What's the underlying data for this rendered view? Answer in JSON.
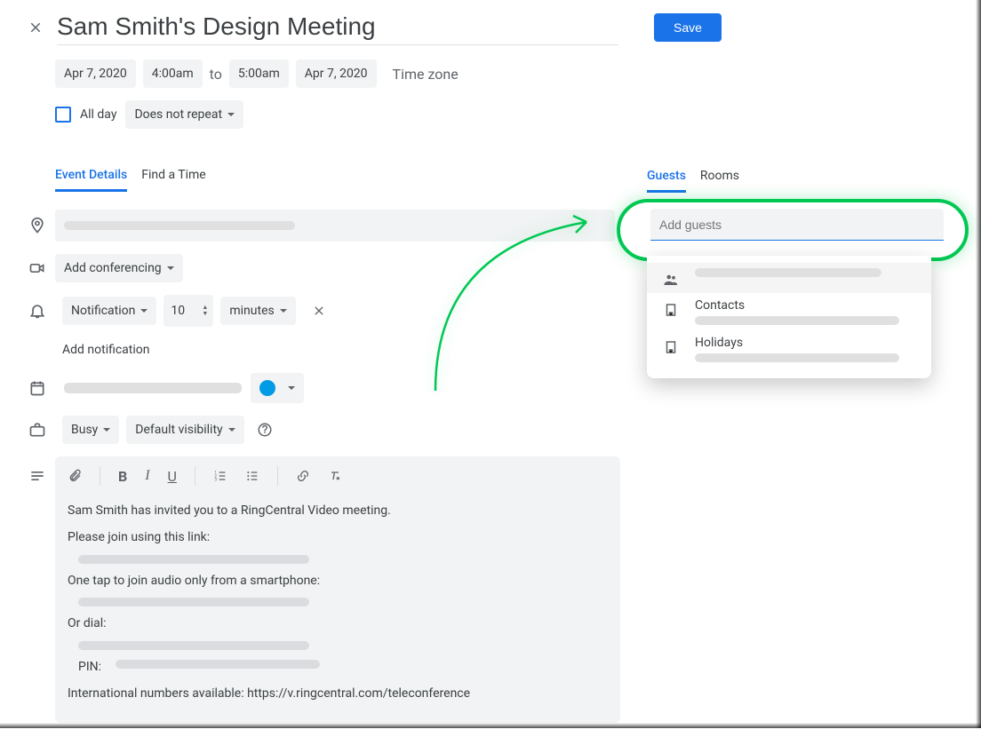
{
  "title": "Sam Smith's Design Meeting",
  "save_label": "Save",
  "dates": {
    "start_date": "Apr 7, 2020",
    "start_time": "4:00am",
    "to": "to",
    "end_time": "5:00am",
    "end_date": "Apr 7, 2020",
    "timezone": "Time zone"
  },
  "allday": {
    "label": "All day",
    "repeat": "Does not repeat"
  },
  "tabs": {
    "details": "Event Details",
    "find": "Find a Time"
  },
  "conferencing": "Add conferencing",
  "notification": {
    "type": "Notification",
    "value": "10",
    "unit": "minutes"
  },
  "add_notification": "Add notification",
  "busy": "Busy",
  "visibility": "Default visibility",
  "description": {
    "line1": "Sam Smith has invited you to a RingCentral Video meeting.",
    "line2": "Please join using this link:",
    "line3": "One tap to join audio only from a smartphone:",
    "line4": "Or dial:",
    "pin": "PIN:",
    "intl": "International numbers available: https://v.ringcentral.com/teleconference"
  },
  "right": {
    "guests_tab": "Guests",
    "rooms_tab": "Rooms",
    "placeholder": "Add guests",
    "suggest": {
      "contacts": "Contacts",
      "holidays": "Holidays"
    }
  }
}
